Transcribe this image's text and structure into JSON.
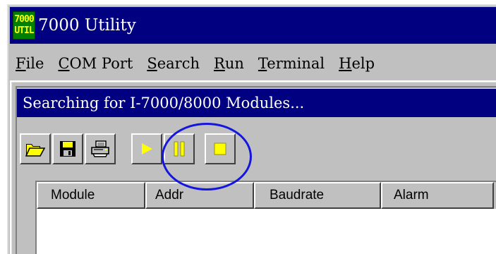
{
  "app": {
    "title": "7000 Utility",
    "icon_lines": [
      "7000",
      "UTIL"
    ]
  },
  "menu": [
    {
      "accel": "F",
      "rest": "ile"
    },
    {
      "accel": "C",
      "rest": "OM Port"
    },
    {
      "accel": "S",
      "rest": "earch"
    },
    {
      "accel": "R",
      "rest": "un"
    },
    {
      "accel": "T",
      "rest": "erminal"
    },
    {
      "accel": "H",
      "rest": "elp"
    }
  ],
  "child": {
    "title": "Searching for I-7000/8000 Modules..."
  },
  "toolbar": {
    "buttons": [
      "open-folder-icon",
      "save-disk-icon",
      "print-icon",
      "play-icon",
      "pause-icon",
      "stop-icon"
    ]
  },
  "list": {
    "columns": [
      "Module",
      "Addr",
      "Baudrate",
      "Alarm"
    ]
  },
  "colors": {
    "titlebar": "#000080",
    "face": "#c0c0c0",
    "annotation": "#1515e0",
    "toolbar_yellow": "#ffff00"
  }
}
